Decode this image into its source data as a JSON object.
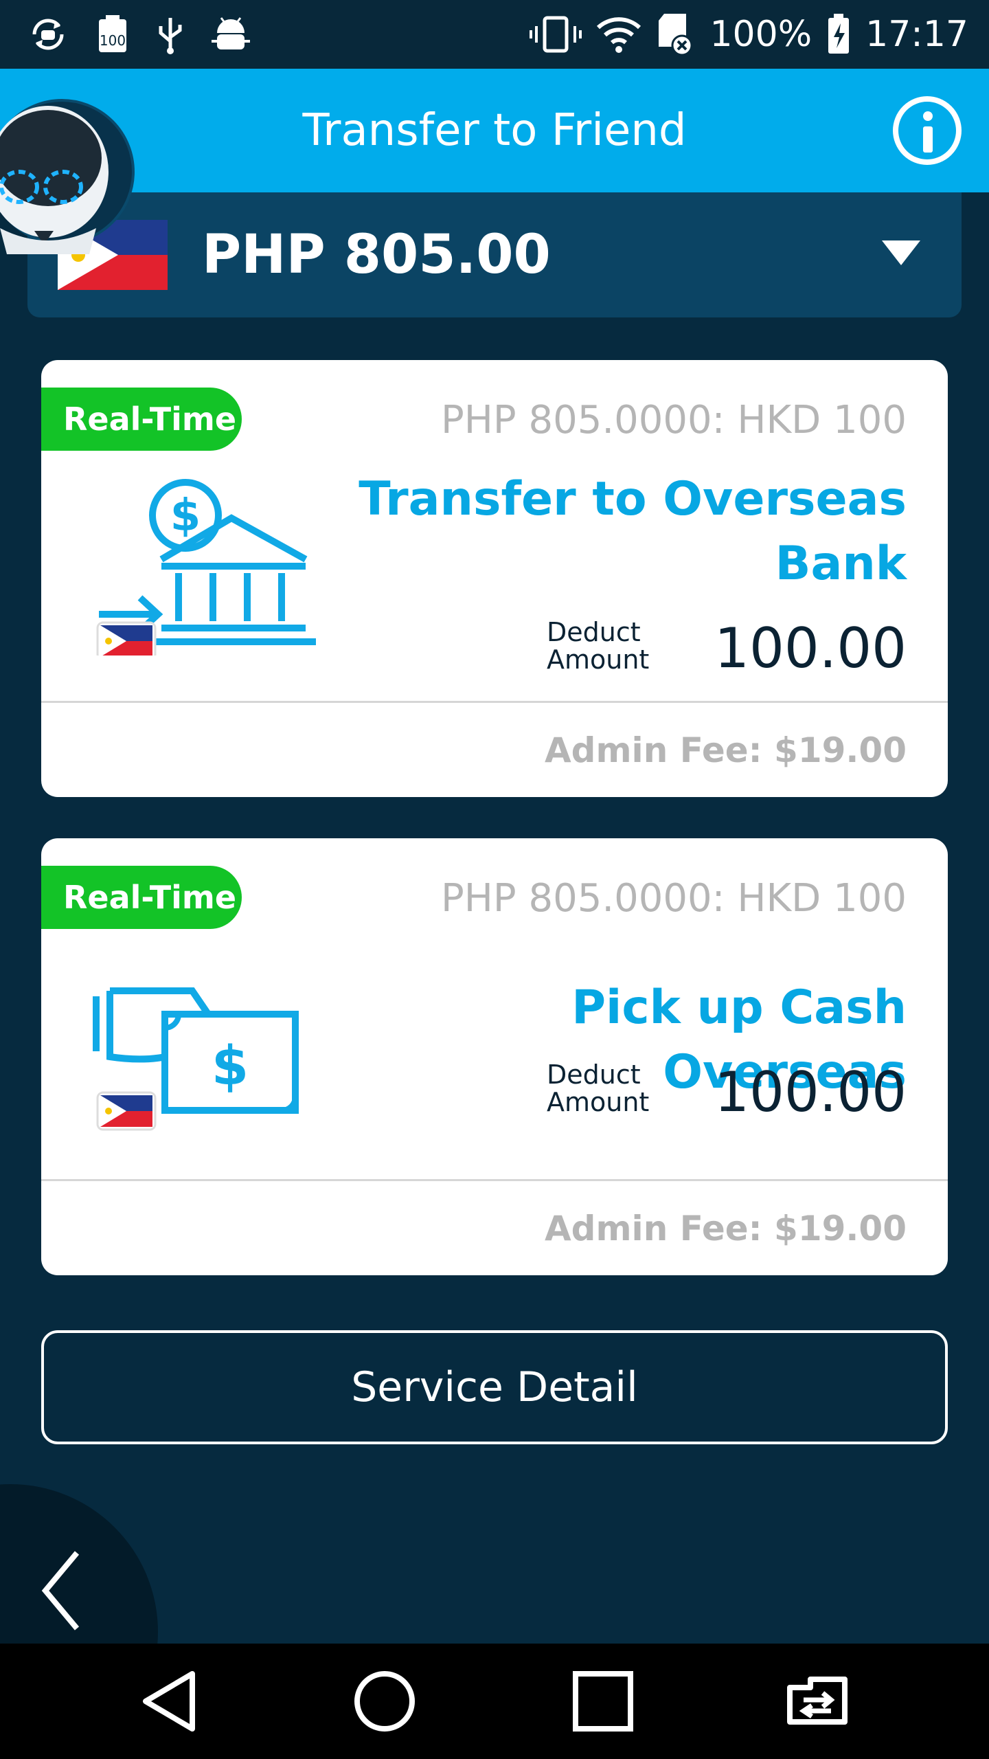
{
  "status_bar": {
    "battery": "100%",
    "time": "17:17",
    "left_icons": [
      "sync-icon",
      "storage-100-icon",
      "usb-icon",
      "android-debug-icon"
    ],
    "right_icons": [
      "vibrate-icon",
      "wifi-icon",
      "sd-card-error-icon",
      "battery-charging-icon"
    ]
  },
  "header": {
    "title": "Transfer to Friend",
    "info_icon": "info-icon"
  },
  "currency": {
    "flag": "philippines-flag",
    "amount": "PHP 805.00"
  },
  "cards": [
    {
      "badge": "Real-Time",
      "rate": "PHP 805.0000: HKD 100",
      "title": "Transfer to Overseas Bank",
      "deduct_label_1": "Deduct",
      "deduct_label_2": "Amount",
      "deduct_amount": "100.00",
      "admin_fee": "Admin Fee: $19.00",
      "icon": "bank-transfer-icon"
    },
    {
      "badge": "Real-Time",
      "rate": "PHP 805.0000: HKD 100",
      "title": "Pick up Cash Overseas",
      "deduct_label_1": "Deduct",
      "deduct_label_2": "Amount",
      "deduct_amount": "100.00",
      "admin_fee": "Admin Fee: $19.00",
      "icon": "cash-pickup-icon"
    }
  ],
  "service_detail_label": "Service Detail",
  "colors": {
    "header_blue": "#01aceb",
    "background": "#062a3f",
    "badge_green": "#13c327",
    "title_blue": "#07a7e3"
  }
}
